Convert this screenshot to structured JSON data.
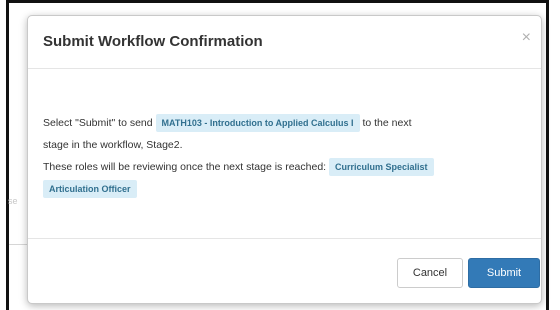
{
  "modal": {
    "title": "Submit Workflow Confirmation",
    "close_glyph": "×",
    "icon": "close-icon",
    "body": {
      "p1_prefix": "Select \"Submit\" to send",
      "course_chip": "MATH103 - Introduction to Applied Calculus I",
      "p1_suffix": "to the next",
      "p1_line2": "stage in the workflow, Stage2.",
      "p2_prefix": "These roles will be reviewing once the next stage is reached:",
      "roles": [
        "Curriculum Specialist",
        "Articulation Officer"
      ]
    },
    "footer": {
      "cancel_label": "Cancel",
      "submit_label": "Submit"
    }
  },
  "colors": {
    "chip_bg": "#d9edf7",
    "chip_text": "#31708f",
    "primary": "#337ab7"
  }
}
